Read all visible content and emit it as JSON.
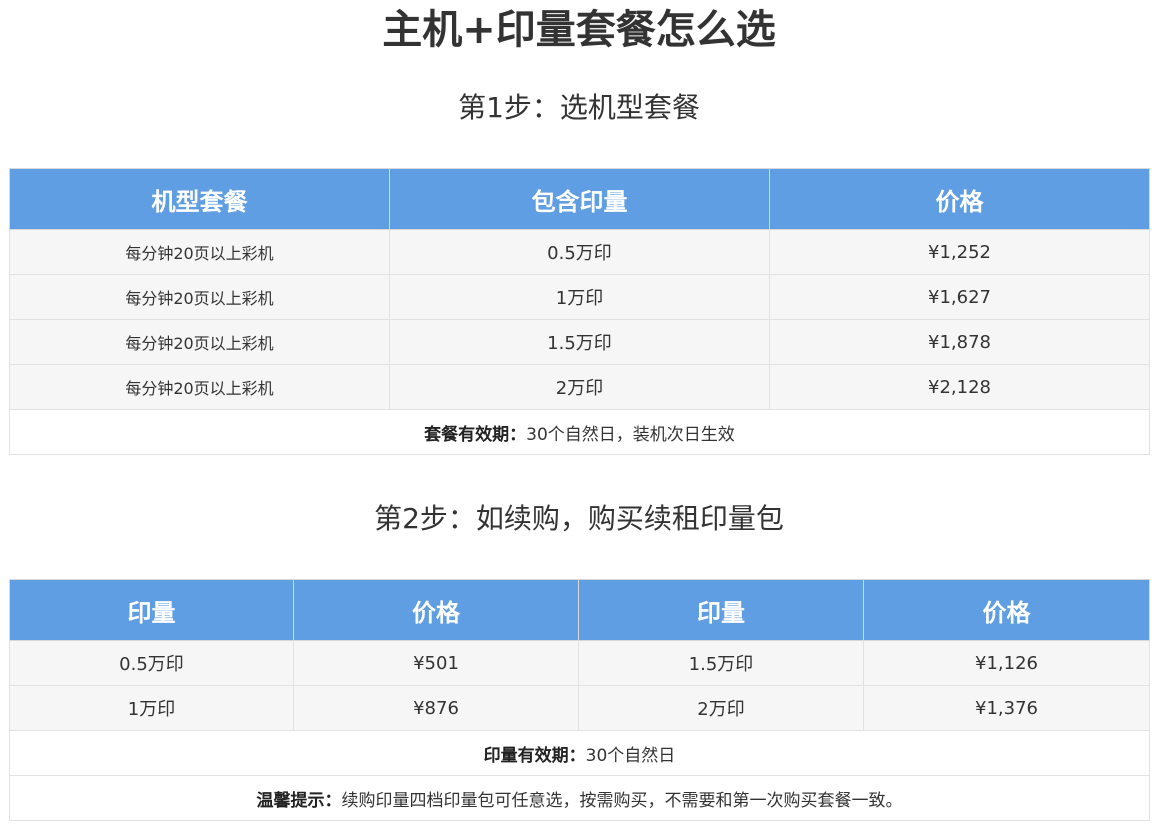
{
  "title": "主机+印量套餐怎么选",
  "step1": {
    "heading": "第1步：选机型套餐",
    "headers": [
      "机型套餐",
      "包含印量",
      "价格"
    ],
    "rows": [
      [
        "每分钟20页以上彩机",
        "0.5万印",
        "¥1,252"
      ],
      [
        "每分钟20页以上彩机",
        "1万印",
        "¥1,627"
      ],
      [
        "每分钟20页以上彩机",
        "1.5万印",
        "¥1,878"
      ],
      [
        "每分钟20页以上彩机",
        "2万印",
        "¥2,128"
      ]
    ],
    "note_label": "套餐有效期：",
    "note_text": "30个自然日，装机次日生效"
  },
  "step2": {
    "heading": "第2步：如续购，购买续租印量包",
    "headers": [
      "印量",
      "价格",
      "印量",
      "价格"
    ],
    "rows": [
      [
        "0.5万印",
        "¥501",
        "1.5万印",
        "¥1,126"
      ],
      [
        "1万印",
        "¥876",
        "2万印",
        "¥1,376"
      ]
    ],
    "validity_label": "印量有效期：",
    "validity_text": "30个自然日",
    "tip_label": "温馨提示：",
    "tip_text": "续购印量四档印量包可任意选，按需购买，不需要和第一次购买套餐一致。"
  },
  "colors": {
    "header_bg": "#5f9ee3",
    "row_bg": "#f6f6f6"
  }
}
